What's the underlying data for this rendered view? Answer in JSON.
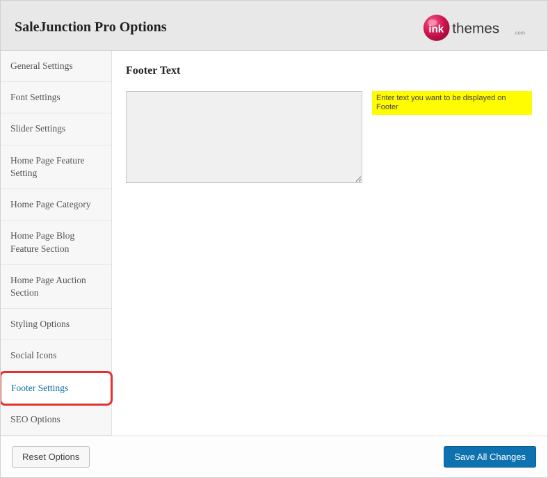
{
  "header": {
    "title": "SaleJunction Pro Options",
    "logo_brand": "inkthemes",
    "logo_accent_color": "#d1174f"
  },
  "sidebar": {
    "items": [
      {
        "label": "General Settings",
        "active": false
      },
      {
        "label": "Font Settings",
        "active": false
      },
      {
        "label": "Slider Settings",
        "active": false
      },
      {
        "label": "Home Page Feature Setting",
        "active": false
      },
      {
        "label": "Home Page Category",
        "active": false
      },
      {
        "label": "Home Page Blog Feature Section",
        "active": false
      },
      {
        "label": "Home Page Auction Section",
        "active": false
      },
      {
        "label": "Styling Options",
        "active": false
      },
      {
        "label": "Social Icons",
        "active": false
      },
      {
        "label": "Footer Settings",
        "active": true
      },
      {
        "label": "SEO Options",
        "active": false
      }
    ]
  },
  "content": {
    "section_title": "Footer Text",
    "textarea_value": "",
    "helper_text": "Enter text you want to be displayed on Footer"
  },
  "footer": {
    "reset_label": "Reset Options",
    "save_label": "Save All Changes"
  },
  "colors": {
    "highlight_red": "#e63030",
    "yellow_highlight": "#fffb00",
    "primary_blue": "#0f72b0"
  }
}
